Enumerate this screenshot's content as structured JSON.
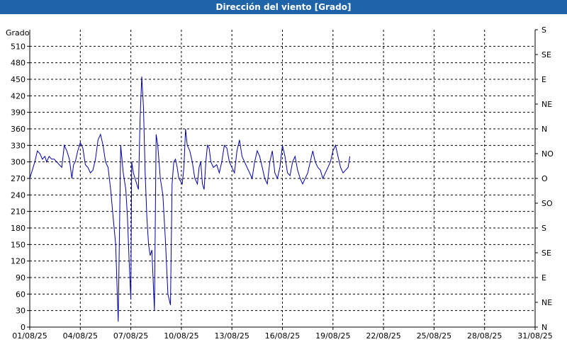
{
  "window": {
    "title": "Dirección del viento [Grado]"
  },
  "colors": {
    "header_bg": "#1f63a8",
    "series": "#0000aa",
    "grid": "#000000"
  },
  "chart_data": {
    "type": "line",
    "title": "Dirección del viento [Grado]",
    "ylabel": "Grado",
    "ylim": [
      0,
      540
    ],
    "yticks": [
      0,
      30,
      60,
      90,
      120,
      150,
      180,
      210,
      240,
      270,
      300,
      330,
      360,
      390,
      420,
      450,
      480,
      510
    ],
    "xticks": [
      "01/08/25",
      "04/08/25",
      "07/08/25",
      "10/08/25",
      "13/08/25",
      "16/08/25",
      "19/08/25",
      "22/08/25",
      "25/08/25",
      "28/08/25",
      "31/08/25"
    ],
    "xlim_days": [
      0,
      30
    ],
    "right_ticks": [
      {
        "value": 0,
        "label": "N"
      },
      {
        "value": 45,
        "label": "NE"
      },
      {
        "value": 90,
        "label": "E"
      },
      {
        "value": 135,
        "label": "SE"
      },
      {
        "value": 180,
        "label": "S"
      },
      {
        "value": 225,
        "label": "SO"
      },
      {
        "value": 270,
        "label": "O"
      },
      {
        "value": 315,
        "label": "NO"
      },
      {
        "value": 360,
        "label": "N"
      },
      {
        "value": 405,
        "label": "NE"
      },
      {
        "value": 450,
        "label": "E"
      },
      {
        "value": 495,
        "label": "SE"
      },
      {
        "value": 540,
        "label": "S"
      }
    ],
    "grid": true,
    "series": [
      {
        "x": [
          0,
          0.15,
          0.3,
          0.45,
          0.6,
          0.75,
          0.9,
          1.0,
          1.15,
          1.3,
          1.45,
          1.6,
          1.75,
          1.9,
          2.05,
          2.2,
          2.35,
          2.5,
          2.6,
          2.7,
          2.85,
          3.0,
          3.15,
          3.3,
          3.45,
          3.6,
          3.75,
          3.9,
          4.05,
          4.2,
          4.35,
          4.5,
          4.65,
          4.8,
          4.95,
          5.1,
          5.25,
          5.4,
          5.55,
          5.7,
          5.8,
          5.9,
          6.0,
          6.05,
          6.15,
          6.25,
          6.35,
          6.45,
          6.55,
          6.65,
          6.75,
          6.85,
          6.95,
          7.05,
          7.15,
          7.25,
          7.4,
          7.5,
          7.6,
          7.75,
          7.9,
          8.05,
          8.2,
          8.35,
          8.45,
          8.55,
          8.65,
          8.75,
          8.85,
          8.95,
          9.05,
          9.15,
          9.25,
          9.35,
          9.5,
          9.65,
          9.8,
          9.95,
          10.05,
          10.15,
          10.25,
          10.35,
          10.45,
          10.55,
          10.65,
          10.75,
          10.9,
          11.1,
          11.25,
          11.4,
          11.55,
          11.7,
          11.85,
          12.0,
          12.15,
          12.3,
          12.45,
          12.6,
          12.75,
          12.9,
          13.05,
          13.2,
          13.35,
          13.5,
          13.65,
          13.8,
          13.95,
          14.1,
          14.25,
          14.4,
          14.55,
          14.7,
          14.85,
          15.0,
          15.15,
          15.3,
          15.45,
          15.6,
          15.75,
          15.9,
          16.05,
          16.2,
          16.35,
          16.5,
          16.65,
          16.8,
          16.95,
          17.1,
          17.25,
          17.4,
          17.55,
          17.7,
          17.85,
          18.0,
          18.15,
          18.3,
          18.45,
          18.6,
          18.75,
          18.9,
          19.0
        ],
        "y": [
          270,
          285,
          300,
          320,
          315,
          305,
          310,
          300,
          310,
          305,
          305,
          300,
          295,
          290,
          330,
          320,
          305,
          270,
          295,
          300,
          320,
          335,
          325,
          295,
          290,
          280,
          285,
          305,
          340,
          350,
          330,
          300,
          290,
          250,
          200,
          150,
          10,
          330,
          280,
          250,
          200,
          120,
          50,
          300,
          280,
          270,
          260,
          250,
          380,
          455,
          400,
          280,
          200,
          150,
          130,
          140,
          30,
          350,
          330,
          270,
          240,
          160,
          60,
          40,
          260,
          300,
          305,
          290,
          270,
          265,
          260,
          290,
          360,
          330,
          320,
          300,
          270,
          260,
          290,
          300,
          260,
          250,
          300,
          330,
          325,
          300,
          290,
          295,
          280,
          300,
          330,
          325,
          300,
          290,
          280,
          320,
          340,
          310,
          300,
          290,
          280,
          270,
          300,
          320,
          310,
          290,
          270,
          260,
          300,
          320,
          280,
          270,
          290,
          330,
          310,
          280,
          275,
          300,
          310,
          285,
          270,
          260,
          270,
          280,
          300,
          320,
          300,
          290,
          285,
          270,
          280,
          290,
          300,
          320,
          330,
          310,
          290,
          280,
          285,
          290,
          310
        ]
      }
    ]
  }
}
